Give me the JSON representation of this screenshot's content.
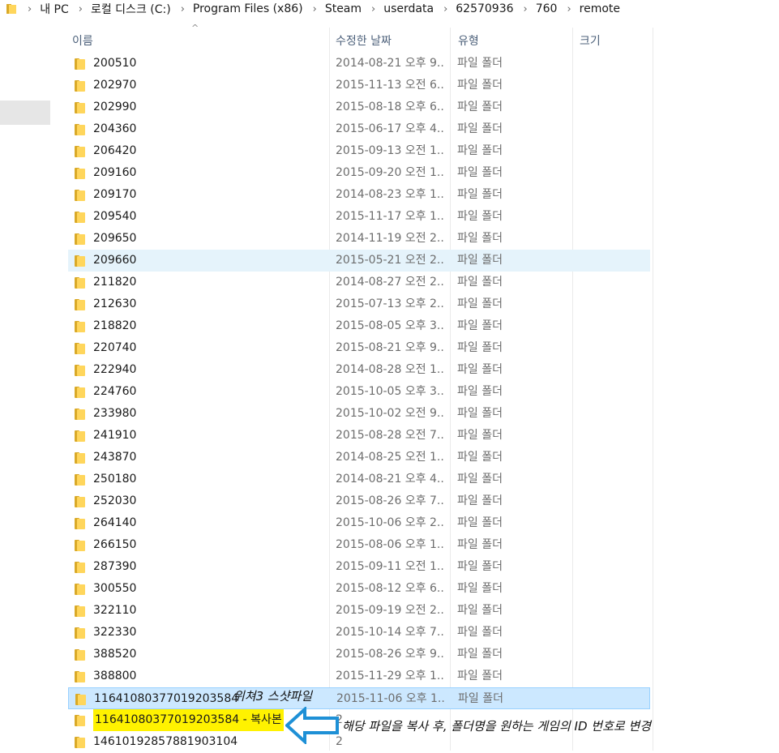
{
  "breadcrumb": {
    "segments": [
      "내 PC",
      "로컬 디스크 (C:)",
      "Program Files (x86)",
      "Steam",
      "userdata",
      "62570936",
      "760",
      "remote"
    ]
  },
  "columns": {
    "name": "이름",
    "date": "수정한 날짜",
    "type": "유형",
    "size": "크기"
  },
  "rows": [
    {
      "name": "200510",
      "date": "2014-08-21 오후 9...",
      "type": "파일 폴더"
    },
    {
      "name": "202970",
      "date": "2015-11-13 오전 6...",
      "type": "파일 폴더"
    },
    {
      "name": "202990",
      "date": "2015-08-18 오후 6...",
      "type": "파일 폴더"
    },
    {
      "name": "204360",
      "date": "2015-06-17 오후 4...",
      "type": "파일 폴더"
    },
    {
      "name": "206420",
      "date": "2015-09-13 오전 1...",
      "type": "파일 폴더"
    },
    {
      "name": "209160",
      "date": "2015-09-20 오전 1...",
      "type": "파일 폴더"
    },
    {
      "name": "209170",
      "date": "2014-08-23 오후 1...",
      "type": "파일 폴더"
    },
    {
      "name": "209540",
      "date": "2015-11-17 오후 1...",
      "type": "파일 폴더"
    },
    {
      "name": "209650",
      "date": "2014-11-19 오전 2...",
      "type": "파일 폴더"
    },
    {
      "name": "209660",
      "date": "2015-05-21 오전 2...",
      "type": "파일 폴더"
    },
    {
      "name": "211820",
      "date": "2014-08-27 오전 2...",
      "type": "파일 폴더"
    },
    {
      "name": "212630",
      "date": "2015-07-13 오후 2...",
      "type": "파일 폴더"
    },
    {
      "name": "218820",
      "date": "2015-08-05 오후 3...",
      "type": "파일 폴더"
    },
    {
      "name": "220740",
      "date": "2015-08-21 오후 9...",
      "type": "파일 폴더"
    },
    {
      "name": "222940",
      "date": "2014-08-28 오전 1...",
      "type": "파일 폴더"
    },
    {
      "name": "224760",
      "date": "2015-10-05 오후 3...",
      "type": "파일 폴더"
    },
    {
      "name": "233980",
      "date": "2015-10-02 오전 9...",
      "type": "파일 폴더"
    },
    {
      "name": "241910",
      "date": "2015-08-28 오전 7...",
      "type": "파일 폴더"
    },
    {
      "name": "243870",
      "date": "2014-08-25 오전 1...",
      "type": "파일 폴더"
    },
    {
      "name": "250180",
      "date": "2014-08-21 오후 4...",
      "type": "파일 폴더"
    },
    {
      "name": "252030",
      "date": "2015-08-26 오후 7...",
      "type": "파일 폴더"
    },
    {
      "name": "264140",
      "date": "2015-10-06 오후 2...",
      "type": "파일 폴더"
    },
    {
      "name": "266150",
      "date": "2015-08-06 오후 1...",
      "type": "파일 폴더"
    },
    {
      "name": "287390",
      "date": "2015-09-11 오전 1...",
      "type": "파일 폴더"
    },
    {
      "name": "300550",
      "date": "2015-08-12 오후 6...",
      "type": "파일 폴더"
    },
    {
      "name": "322110",
      "date": "2015-09-19 오전 2...",
      "type": "파일 폴더"
    },
    {
      "name": "322330",
      "date": "2015-10-14 오후 7...",
      "type": "파일 폴더"
    },
    {
      "name": "388520",
      "date": "2015-08-26 오후 9...",
      "type": "파일 폴더"
    },
    {
      "name": "388800",
      "date": "2015-11-29 오후 1...",
      "type": "파일 폴더"
    },
    {
      "name": "11641080377019203584",
      "date": "2015-11-06 오후 1...",
      "type": "파일 폴더"
    },
    {
      "name": "11641080377019203584 - 복사본",
      "date": "2",
      "type": ""
    },
    {
      "name": "14610192857881903104",
      "date": "2",
      "type": ""
    }
  ],
  "annotations": {
    "witcher_label": "위쳐3 스샷파일",
    "instruction": "해당 파일을 복사 후, 폴더명을 원하는 게임의 ID 번호로 변경",
    "arrow_color": "#1e90d6",
    "highlight_color": "#fff200"
  },
  "colors": {
    "hover_row": "#e5f3fb",
    "selected_row": "#cce8ff",
    "folder_yellow": "#ffd65c"
  }
}
